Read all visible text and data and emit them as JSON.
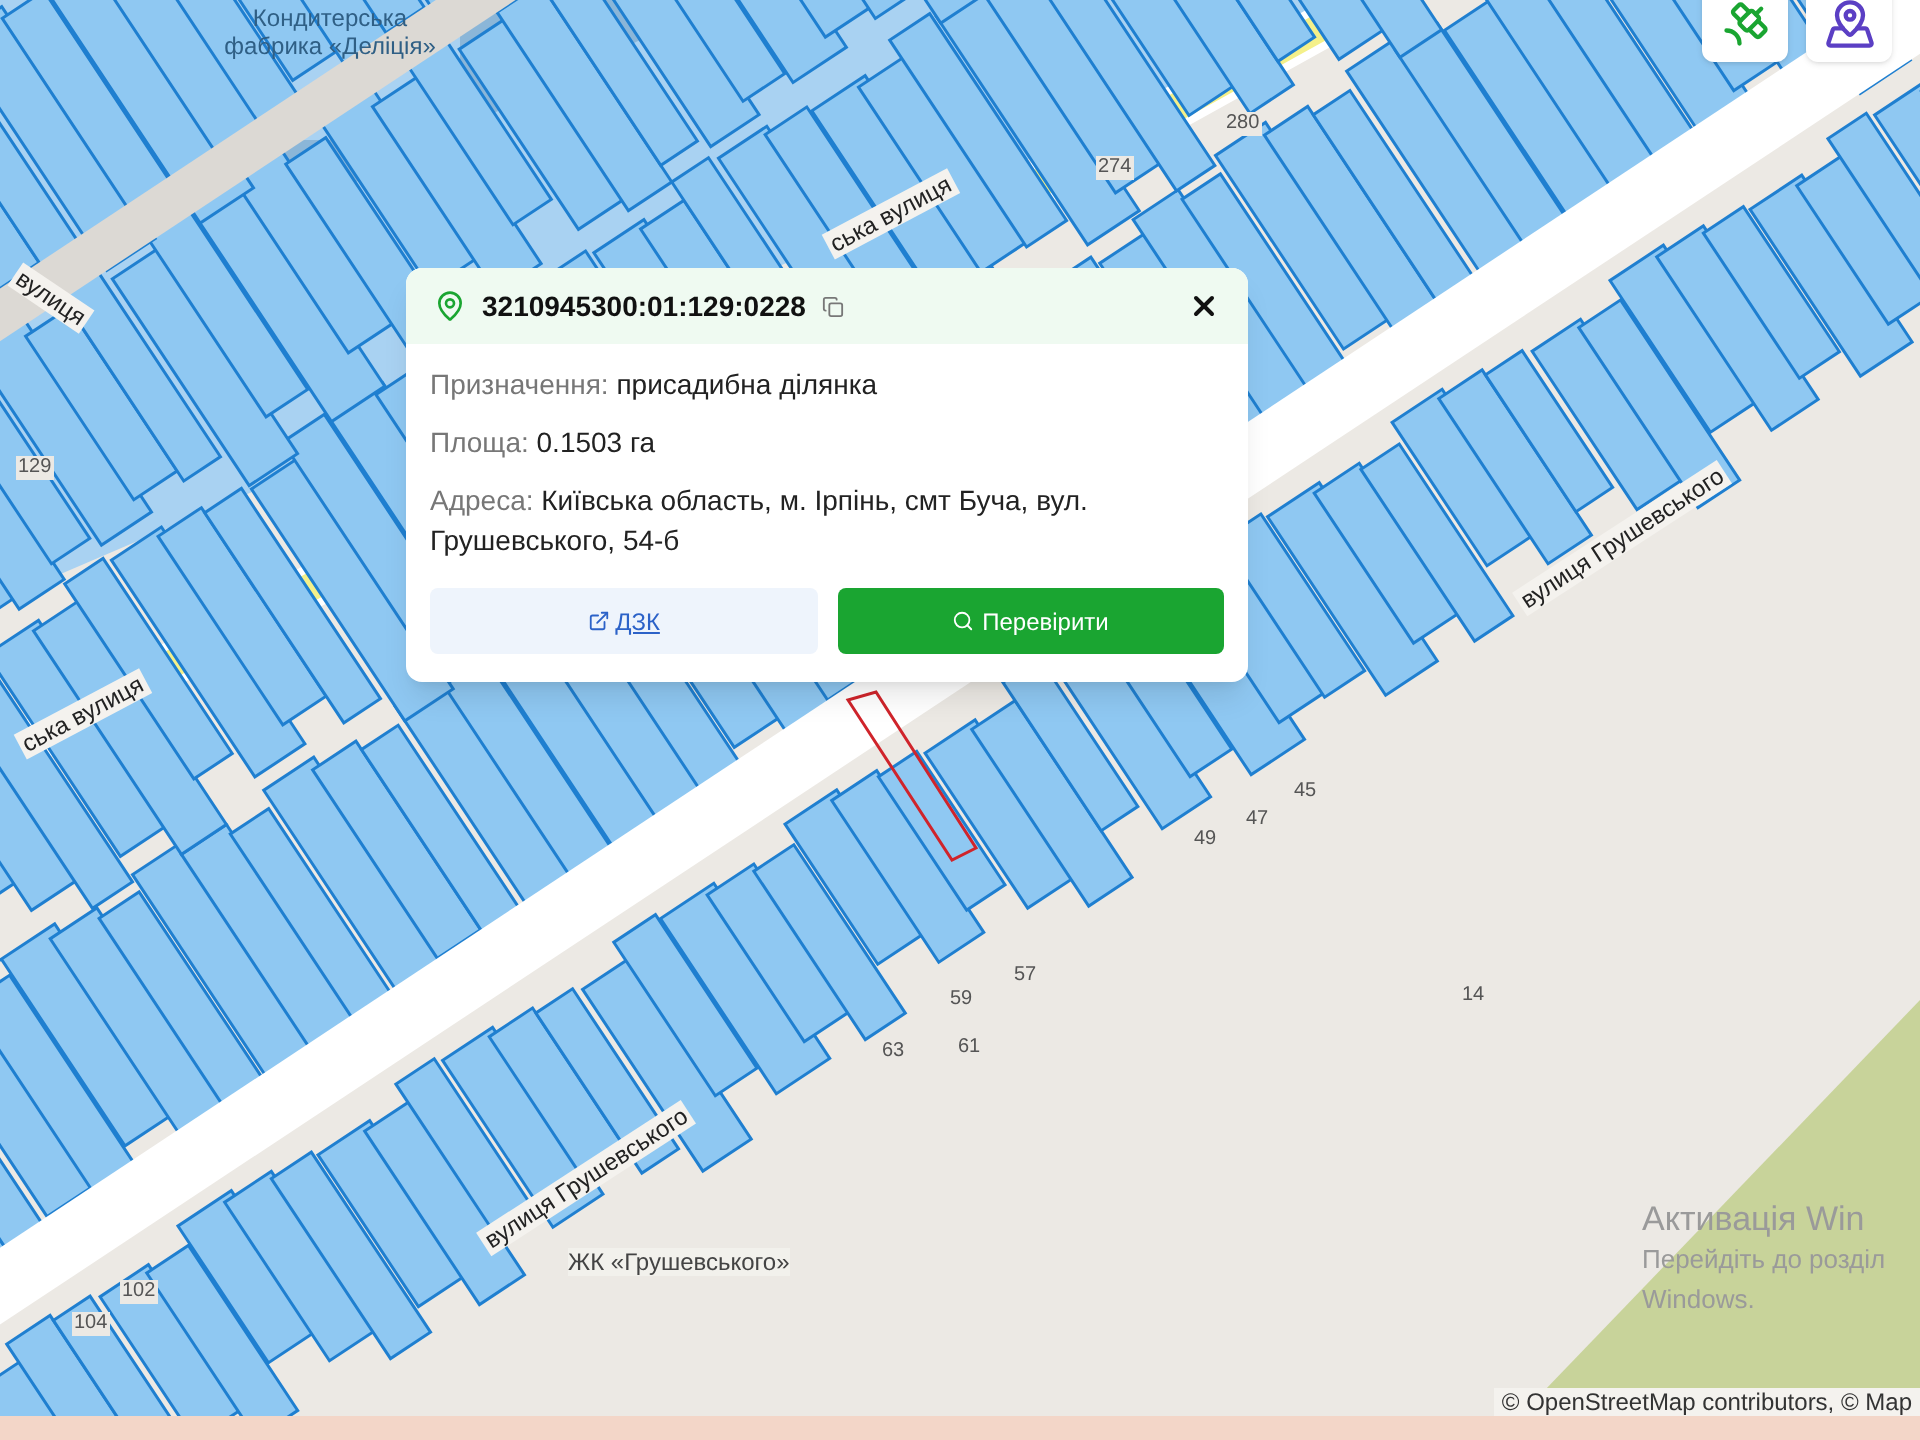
{
  "map": {
    "labels": [
      {
        "kind": "poi",
        "text": "Кондитерська фабрика «Деліція»"
      },
      {
        "kind": "street",
        "text": "ська вулиця"
      },
      {
        "kind": "street",
        "text": "вулиця"
      },
      {
        "kind": "street",
        "text": "ська вулиця"
      },
      {
        "kind": "street",
        "text": "вулиця Грушевського"
      },
      {
        "kind": "street",
        "text": "вулиця Грушевського"
      },
      {
        "kind": "poi",
        "text": "ЖК «Грушевського»"
      },
      {
        "kind": "number",
        "text": "280"
      },
      {
        "kind": "number",
        "text": "274"
      },
      {
        "kind": "number",
        "text": "129"
      },
      {
        "kind": "number",
        "text": "59"
      },
      {
        "kind": "number",
        "text": "57"
      },
      {
        "kind": "number",
        "text": "63"
      },
      {
        "kind": "number",
        "text": "61"
      },
      {
        "kind": "number",
        "text": "45"
      },
      {
        "kind": "number",
        "text": "47"
      },
      {
        "kind": "number",
        "text": "49"
      },
      {
        "kind": "number",
        "text": "14"
      },
      {
        "kind": "number",
        "text": "102"
      },
      {
        "kind": "number",
        "text": "104"
      }
    ],
    "attribution": "© OpenStreetMap contributors, © Map"
  },
  "map_controls": [
    {
      "kind": "satellite"
    },
    {
      "kind": "map"
    }
  ],
  "popup": {
    "cadastral_number": "3210945300:01:129:0228",
    "fields": [
      {
        "label": "Призначення:",
        "value": "присадибна ділянка"
      },
      {
        "label": "Площа:",
        "value": "0.1503 га"
      },
      {
        "label": "Адреса:",
        "value": "Київська область, м. Ірпінь, смт Буча, вул. Грушевського, 54-б"
      }
    ],
    "link_button": "ДЗК",
    "check_button": "Перевірити"
  },
  "os_notice": {
    "title": "Активація Win",
    "lines": [
      "Перейдіть до розділ",
      "Windows."
    ]
  }
}
